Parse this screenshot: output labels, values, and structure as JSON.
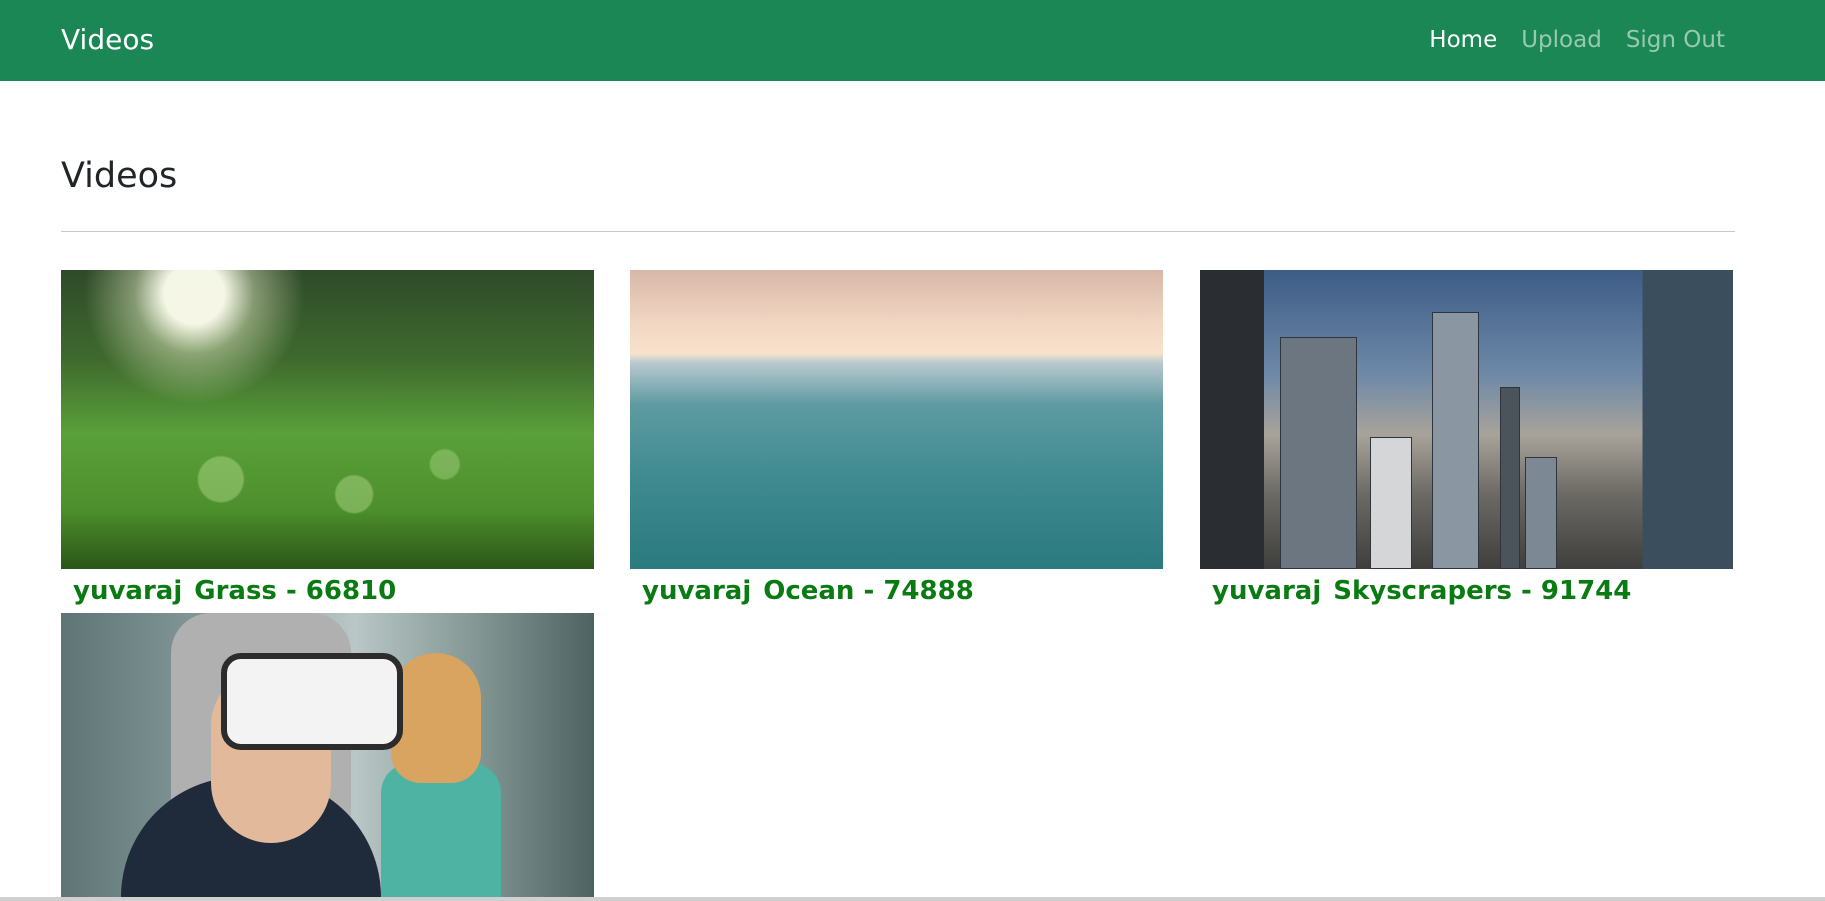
{
  "navbar": {
    "brand": "Videos",
    "links": [
      {
        "label": "Home",
        "active": true
      },
      {
        "label": "Upload",
        "active": false
      },
      {
        "label": "Sign Out",
        "active": false
      }
    ],
    "color": "#1a8754"
  },
  "main": {
    "title": "Videos",
    "videos": [
      {
        "user": "yuvaraj",
        "title": "Grass - 66810",
        "thumbnail": "grass-scene"
      },
      {
        "user": "yuvaraj",
        "title": "Ocean - 74888",
        "thumbnail": "ocean-scene"
      },
      {
        "user": "yuvaraj",
        "title": "Skyscrapers - 91744",
        "thumbnail": "city-scene"
      },
      {
        "user": "",
        "title": "",
        "thumbnail": "vr-kids-scene"
      }
    ]
  },
  "colors": {
    "caption": "#0a7a12",
    "title": "#212529"
  }
}
